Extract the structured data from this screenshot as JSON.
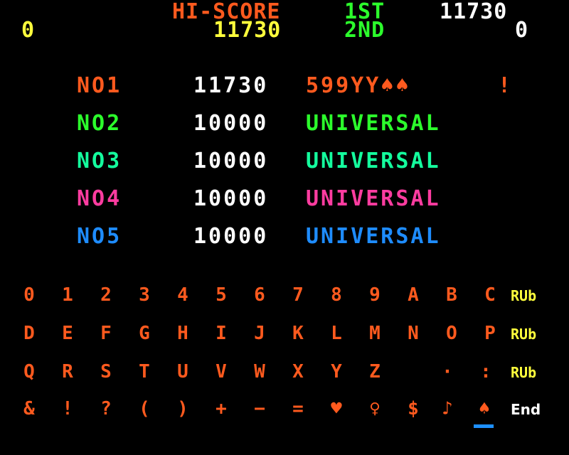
{
  "header": {
    "hiscore_label": "HI-SCORE",
    "first_label": "1ST",
    "first_score": "11730",
    "hiscore_value": "11730",
    "second_label": "2ND",
    "player1_score": "0",
    "player2_score": "0"
  },
  "ranking": [
    {
      "rank": "NO1",
      "score": "11730",
      "name": "599YY♠♠",
      "extra": "!"
    },
    {
      "rank": "NO2",
      "score": "10000",
      "name": "UNIVERSAL"
    },
    {
      "rank": "NO3",
      "score": "10000",
      "name": "UNIVERSAL"
    },
    {
      "rank": "NO4",
      "score": "10000",
      "name": "UNIVERSAL"
    },
    {
      "rank": "NO5",
      "score": "10000",
      "name": "UNIVERSAL"
    }
  ],
  "keyboard": {
    "rows": [
      [
        "0",
        "1",
        "2",
        "3",
        "4",
        "5",
        "6",
        "7",
        "8",
        "9",
        "A",
        "B",
        "C"
      ],
      [
        "D",
        "E",
        "F",
        "G",
        "H",
        "I",
        "J",
        "K",
        "L",
        "M",
        "N",
        "O",
        "P"
      ],
      [
        "Q",
        "R",
        "S",
        "T",
        "U",
        "V",
        "W",
        "X",
        "Y",
        "Z",
        "",
        "·",
        ":"
      ],
      [
        "&",
        "!",
        "?",
        "(",
        ")",
        "+",
        "−",
        "=",
        "♥",
        "♀",
        "$",
        "♪",
        "♠"
      ]
    ],
    "side": [
      "RUb",
      "RUb",
      "RUb",
      "End"
    ]
  },
  "colors": {
    "orange": "#ff5a1e",
    "yellow": "#ffff3c",
    "green": "#2cff2c",
    "teal": "#14ff9e",
    "pink": "#ff3ca0",
    "blue": "#1e8cff",
    "white": "#ffffff"
  }
}
